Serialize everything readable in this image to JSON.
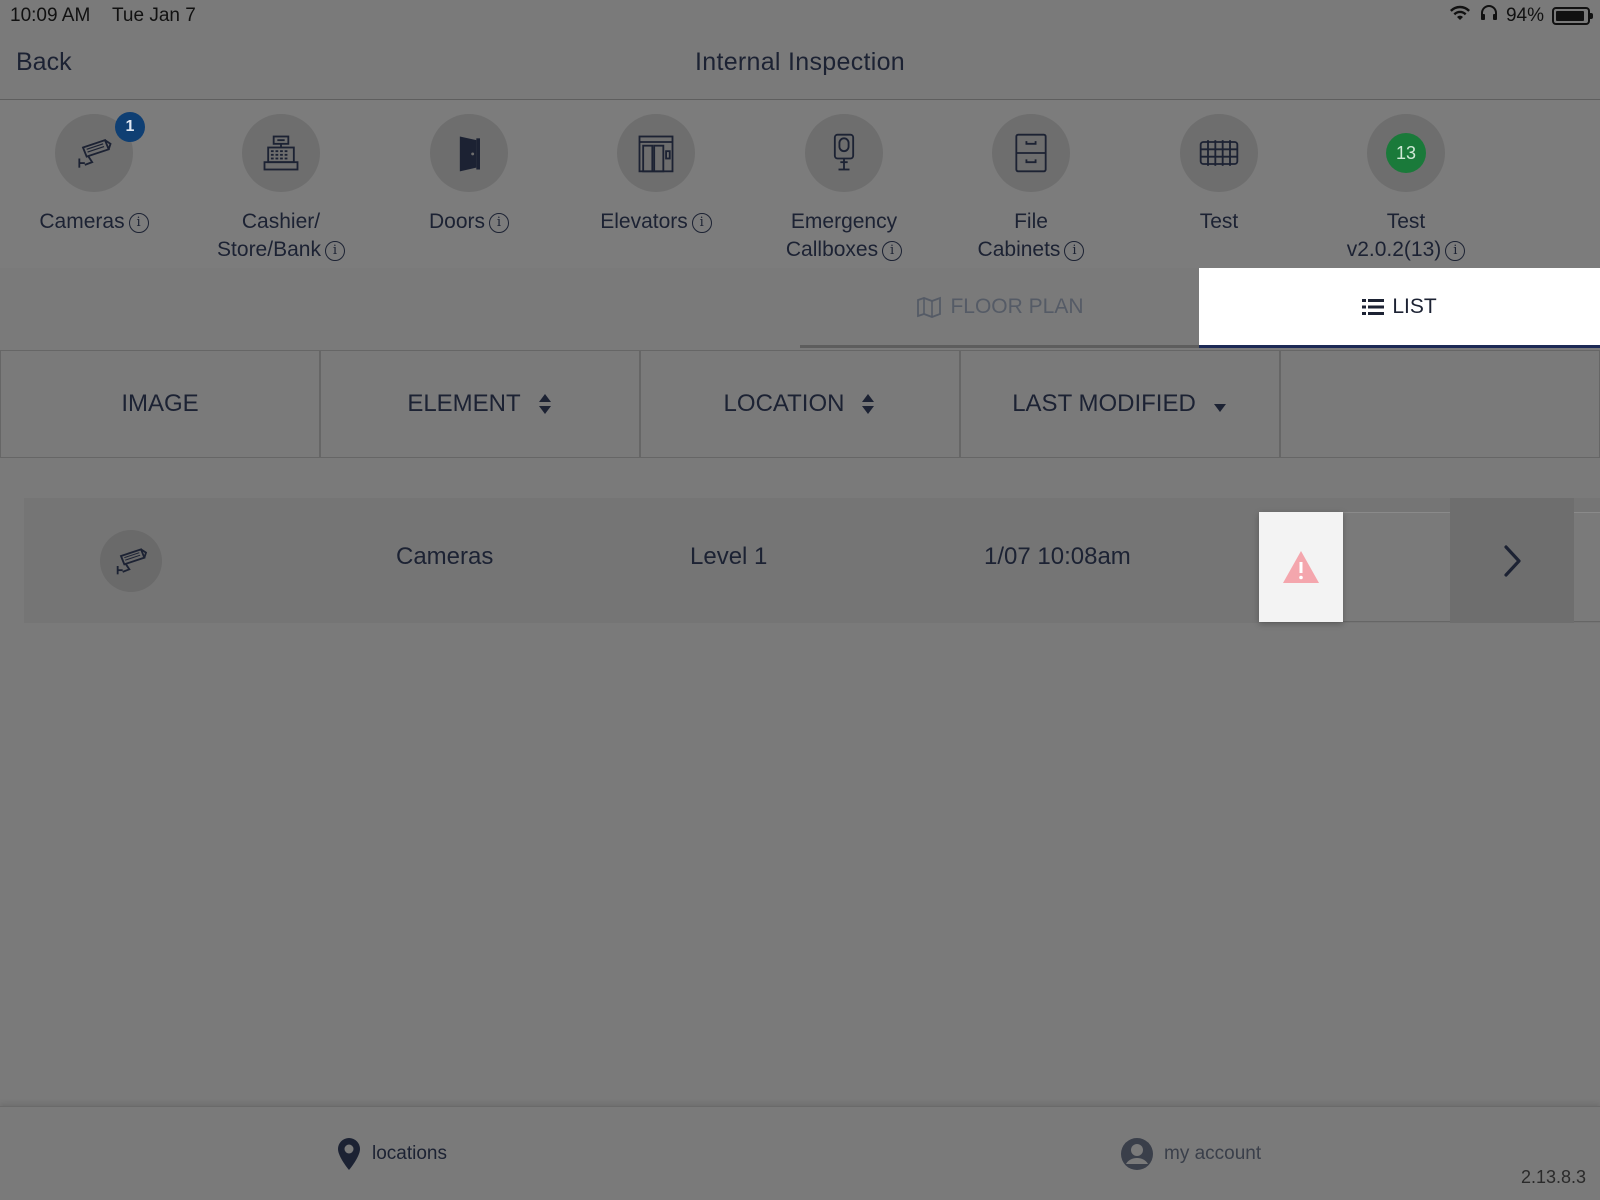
{
  "status_bar": {
    "time": "10:09 AM",
    "date": "Tue Jan 7",
    "battery": "94%",
    "battery_level": 0.94
  },
  "nav": {
    "back_label": "Back",
    "title": "Internal Inspection"
  },
  "categories": [
    {
      "line1": "Cameras",
      "line2": "",
      "info": true,
      "badge": "1",
      "icon": "security-camera-icon"
    },
    {
      "line1": "Cashier/",
      "line2": "Store/Bank",
      "info": true,
      "badge": "",
      "icon": "cash-register-icon"
    },
    {
      "line1": "Doors",
      "line2": "",
      "info": true,
      "badge": "",
      "icon": "door-icon"
    },
    {
      "line1": "Elevators",
      "line2": "",
      "info": true,
      "badge": "",
      "icon": "elevator-icon"
    },
    {
      "line1": "Emergency",
      "line2": "Callboxes",
      "info": true,
      "badge": "",
      "icon": "callbox-icon"
    },
    {
      "line1": "File",
      "line2": "Cabinets",
      "info": true,
      "badge": "",
      "icon": "file-cabinet-icon"
    },
    {
      "line1": "Test",
      "line2": "",
      "info": false,
      "badge": "",
      "icon": "fence-icon"
    },
    {
      "line1": "Test",
      "line2": "v2.0.2(13)",
      "info": true,
      "badge": "",
      "count": "13",
      "icon": "count-circle"
    }
  ],
  "segments": {
    "floor_plan": "FLOOR PLAN",
    "list": "LIST",
    "active": "list"
  },
  "table": {
    "headers": {
      "image": "IMAGE",
      "element": "ELEMENT",
      "location": "LOCATION",
      "last_modified": "LAST MODIFIED"
    },
    "rows": [
      {
        "element": "Cameras",
        "location": "Level 1",
        "last_modified": "1/07 10:08am",
        "image_icon": "security-camera-icon",
        "status_icon": "warning-icon"
      }
    ]
  },
  "footer": {
    "locations_label": "locations",
    "account_label": "my account",
    "version": "2.13.8.3"
  },
  "colors": {
    "primary": "#1c2233",
    "badge_blue": "#0f3f73",
    "count_green": "#1a7a3a",
    "warning": "#f4a6ad"
  }
}
